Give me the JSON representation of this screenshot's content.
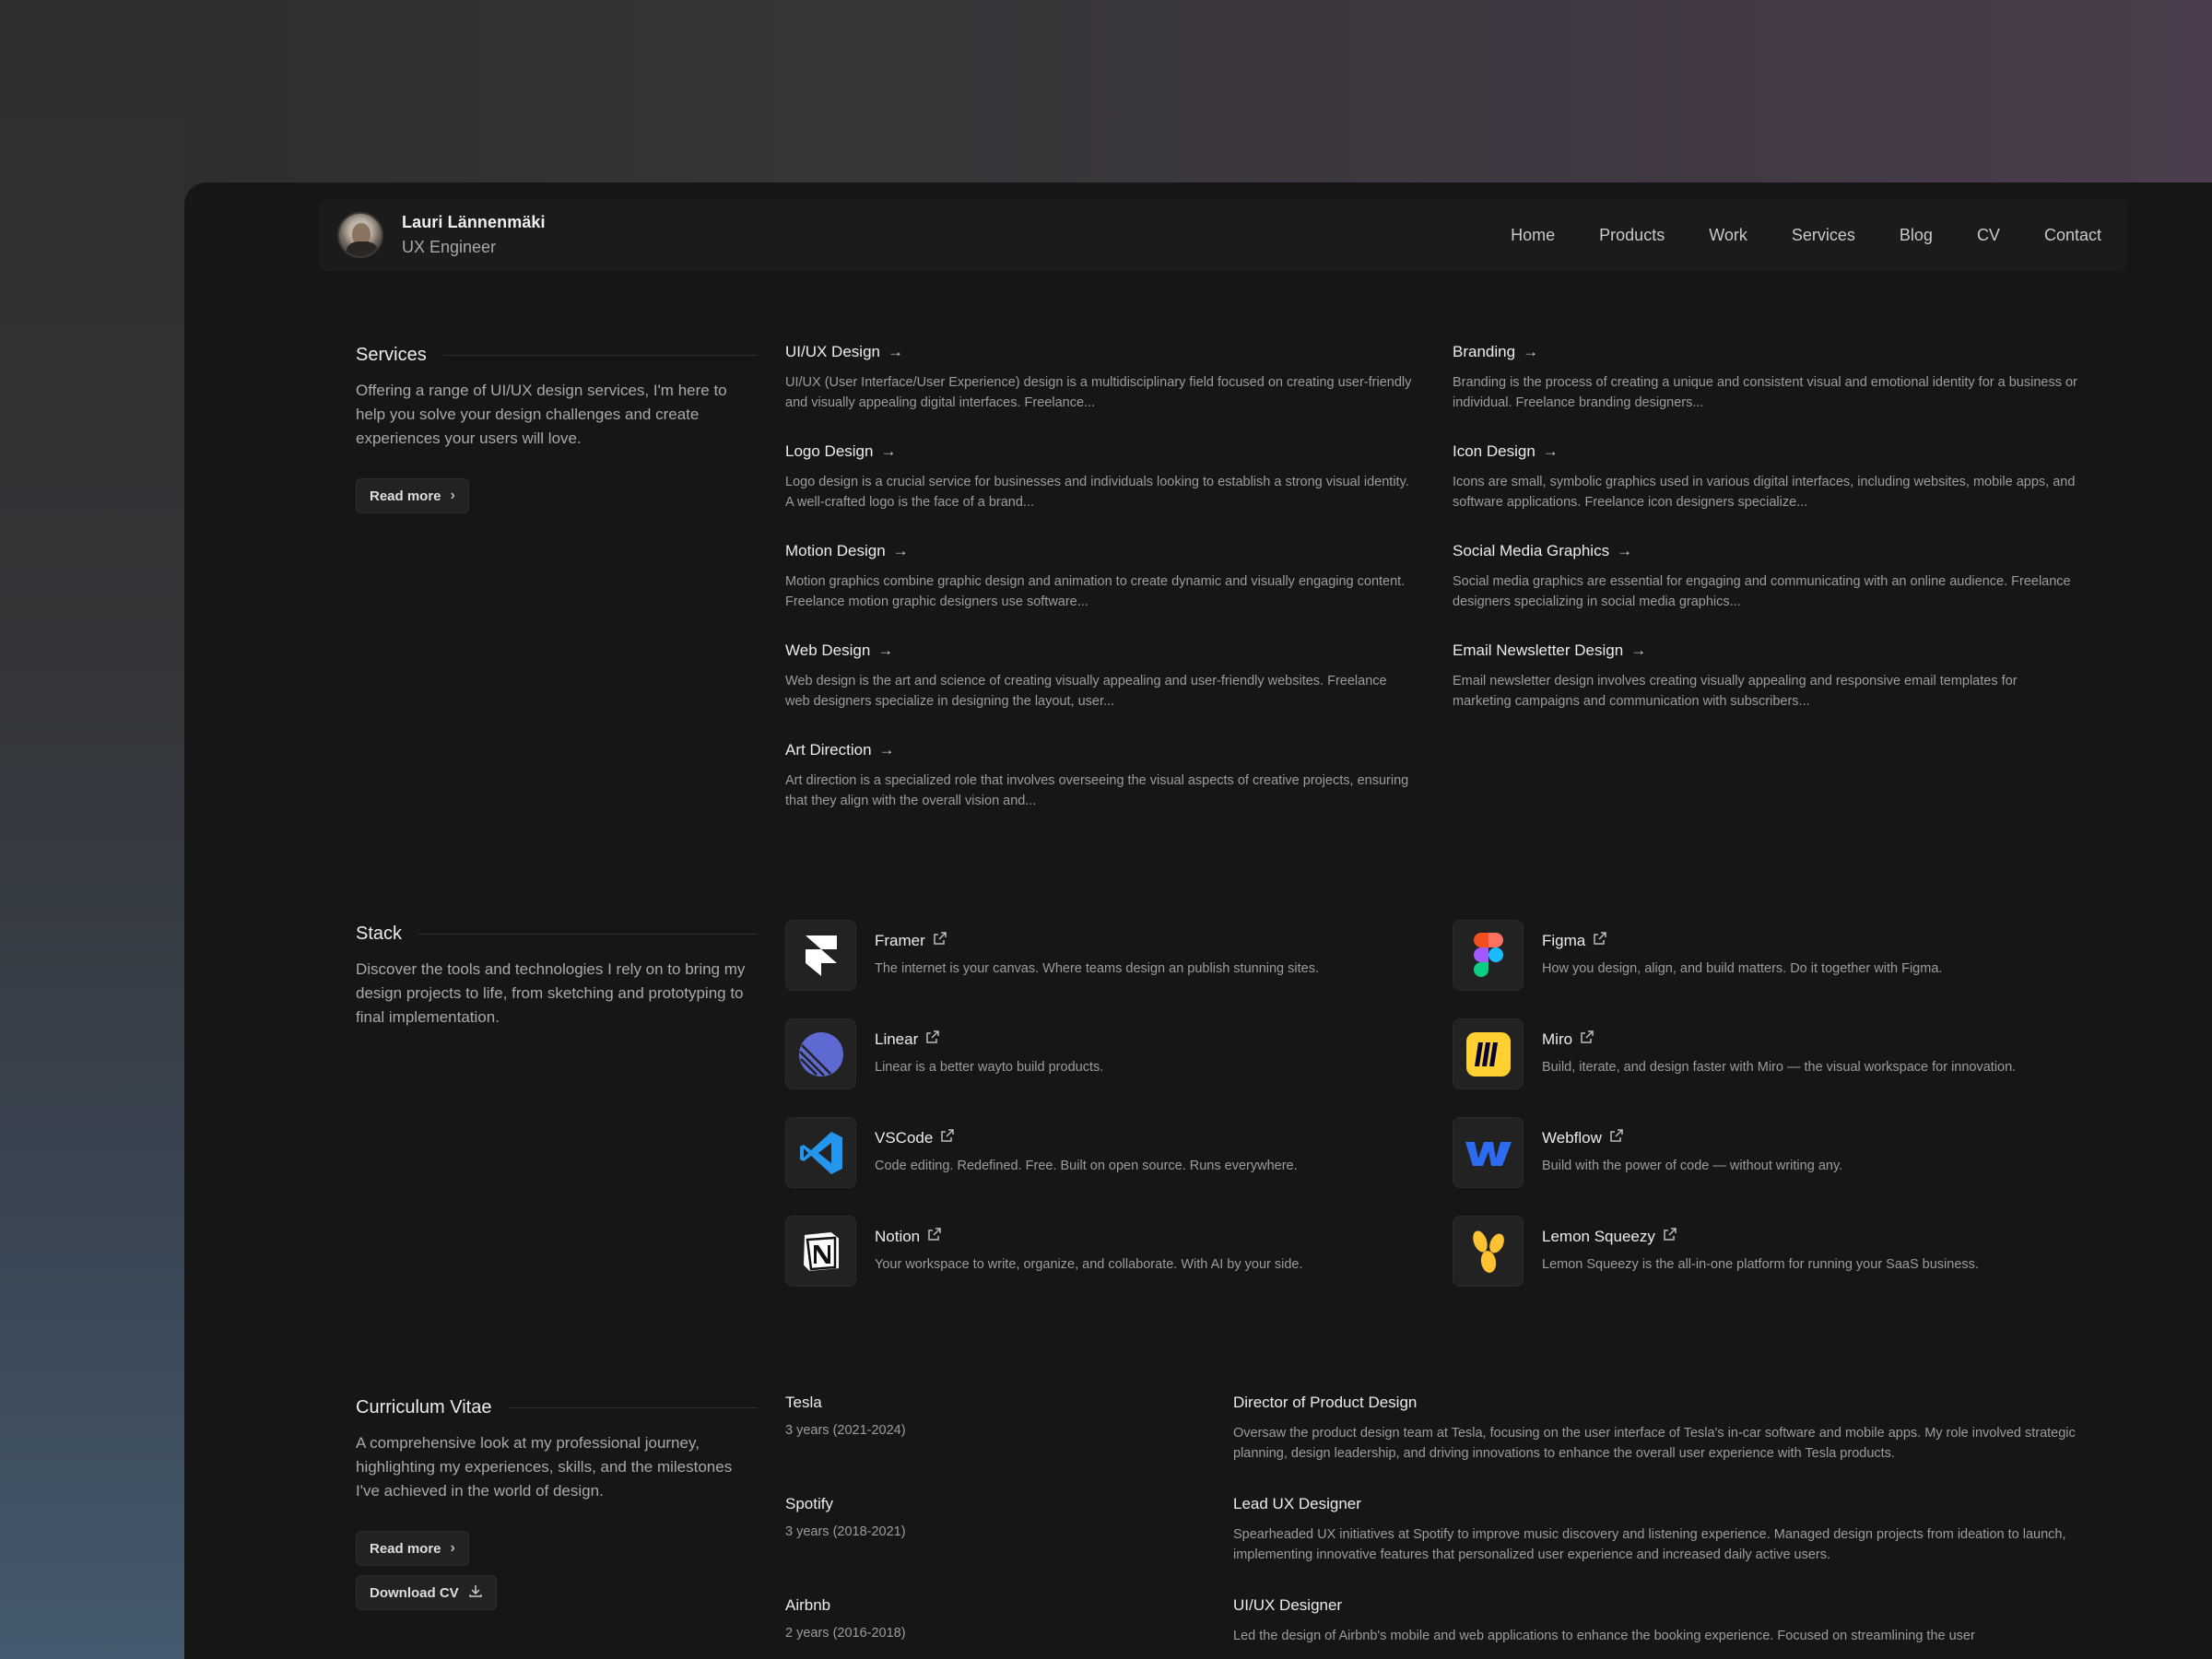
{
  "header": {
    "name": "Lauri Lännenmäki",
    "role": "UX Engineer",
    "nav": [
      "Home",
      "Products",
      "Work",
      "Services",
      "Blog",
      "CV",
      "Contact"
    ]
  },
  "services": {
    "title": "Services",
    "description": "Offering a range of UI/UX design services, I'm here to help you solve your design challenges and create experiences your users will love.",
    "read_more": "Read more",
    "items": [
      {
        "title": "UI/UX Design",
        "desc": "UI/UX (User Interface/User Experience) design is a multidisciplinary field focused on creating user-friendly and visually appealing digital interfaces. Freelance..."
      },
      {
        "title": "Branding",
        "desc": "Branding is the process of creating a unique and consistent visual and emotional identity for a business or individual. Freelance branding designers..."
      },
      {
        "title": "Logo Design",
        "desc": "Logo design is a crucial service for businesses and individuals looking to establish a strong visual identity. A well-crafted logo is the face of a brand..."
      },
      {
        "title": "Icon Design",
        "desc": "Icons are small, symbolic graphics used in various digital interfaces, including websites, mobile apps, and software applications. Freelance icon designers specialize..."
      },
      {
        "title": "Motion Design",
        "desc": "Motion graphics combine graphic design and animation to create dynamic and visually engaging content. Freelance motion graphic designers use software..."
      },
      {
        "title": "Social Media Graphics",
        "desc": "Social media graphics are essential for engaging and communicating with an online audience. Freelance designers specializing in social media graphics..."
      },
      {
        "title": "Web Design",
        "desc": "Web design is the art and science of creating visually appealing and user-friendly websites. Freelance web designers specialize in designing the layout, user..."
      },
      {
        "title": "Email Newsletter Design",
        "desc": "Email newsletter design involves creating visually appealing and responsive email templates for marketing campaigns and communication with subscribers..."
      },
      {
        "title": "Art Direction",
        "desc": "Art direction is a specialized role that involves overseeing the visual aspects of creative projects, ensuring that they align with the overall vision and..."
      }
    ]
  },
  "stack": {
    "title": "Stack",
    "description": "Discover the tools and technologies I rely on to bring my design projects to life, from sketching and prototyping to final implementation.",
    "items": [
      {
        "name": "Framer",
        "icon": "framer-icon",
        "desc": "The internet is your canvas. Where teams design an publish stunning sites."
      },
      {
        "name": "Figma",
        "icon": "figma-icon",
        "desc": "How you design, align, and build matters. Do it together with Figma."
      },
      {
        "name": "Linear",
        "icon": "linear-icon",
        "desc": "Linear is a better wayto build products."
      },
      {
        "name": "Miro",
        "icon": "miro-icon",
        "desc": "Build, iterate, and design faster with Miro — the visual workspace for innovation."
      },
      {
        "name": "VSCode",
        "icon": "vscode-icon",
        "desc": "Code editing. Redefined. Free. Built on open source. Runs everywhere."
      },
      {
        "name": "Webflow",
        "icon": "webflow-icon",
        "desc": "Build with the power of code — without writing any."
      },
      {
        "name": "Notion",
        "icon": "notion-icon",
        "desc": "Your workspace to write, organize, and collaborate. With AI by your side."
      },
      {
        "name": "Lemon Squeezy",
        "icon": "lemon-squeezy-icon",
        "desc": "Lemon Squeezy is the all-in-one platform for running your SaaS business."
      }
    ]
  },
  "cv": {
    "title": "Curriculum Vitae",
    "description": "A comprehensive look at my professional journey, highlighting my experiences, skills, and the milestones I've achieved in the world of design.",
    "read_more": "Read more",
    "download": "Download CV",
    "items": [
      {
        "company": "Tesla",
        "years": "3 years (2021-2024)",
        "role": "Director of Product Design",
        "desc": "Oversaw the product design team at Tesla, focusing on the user interface of Tesla's in-car software and mobile apps. My role involved strategic planning, design leadership, and driving innovations to enhance the overall user experience with Tesla products."
      },
      {
        "company": "Spotify",
        "years": "3 years (2018-2021)",
        "role": "Lead UX Designer",
        "desc": "Spearheaded UX initiatives at Spotify to improve music discovery and listening experience. Managed design projects from ideation to launch, implementing innovative features that personalized user experience and increased daily active users."
      },
      {
        "company": "Airbnb",
        "years": "2 years (2016-2018)",
        "role": "UI/UX Designer",
        "desc": "Led the design of Airbnb's mobile and web applications to enhance the booking experience. Focused on streamlining the user"
      }
    ]
  },
  "colors": {
    "window_bg": "#161616",
    "text_primary": "#ececec",
    "text_secondary": "#9c9c9c"
  }
}
